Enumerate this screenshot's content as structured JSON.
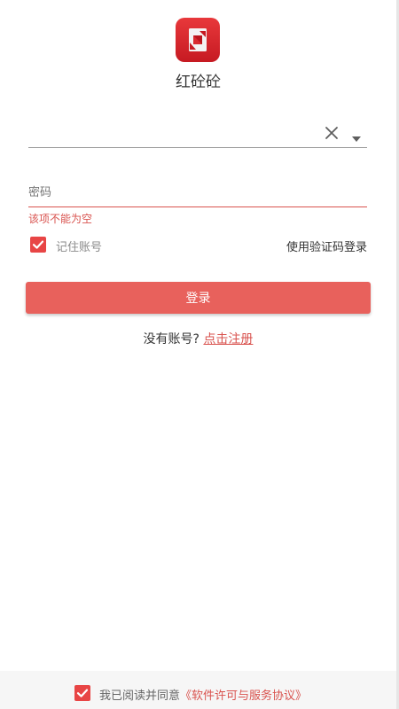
{
  "app": {
    "name": "红砼砼",
    "accent_color": "#e8615c",
    "error_color": "#d9534f",
    "logo_icon": "app-logo-icon"
  },
  "account": {
    "value": "",
    "placeholder": "",
    "clear_icon": "close-icon",
    "dropdown_icon": "caret-down-icon"
  },
  "password": {
    "value": "",
    "placeholder": "密码",
    "error": "该项不能为空"
  },
  "remember": {
    "checked": true,
    "label": "记住账号"
  },
  "sms_login_label": "使用验证码登录",
  "login_button_label": "登录",
  "register": {
    "prompt": "没有账号?",
    "link_label": "点击注册"
  },
  "footer": {
    "agree_checked": true,
    "agree_prefix": "我已阅读并同意",
    "agreement_link": "《软件许可与服务协议》"
  }
}
